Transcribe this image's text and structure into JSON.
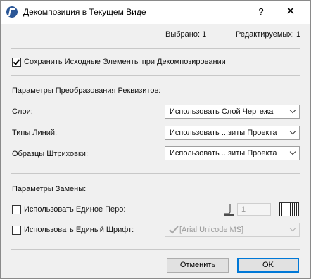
{
  "window": {
    "title": "Декомпозиция в Текущем Виде",
    "help": "?",
    "close": "✕"
  },
  "status": {
    "selected": "Выбрано: 1",
    "editable": "Редактируемых: 1"
  },
  "keep_original": {
    "label": "Сохранить Исходные Элементы при Декомпозировании",
    "checked": true
  },
  "attributes": {
    "heading": "Параметры Преобразования Реквизитов:",
    "layers": {
      "label": "Слои:",
      "value": "Использовать Слой Чертежа"
    },
    "line_types": {
      "label": "Типы Линий:",
      "value": "Использовать ...зиты Проекта"
    },
    "hatches": {
      "label": "Образцы Штриховки:",
      "value": "Использовать ...зиты Проекта"
    }
  },
  "overrides": {
    "heading": "Параметры Замены:",
    "single_pen": {
      "label": "Использовать Единое Перо:",
      "checked": false,
      "pen_number": "1"
    },
    "single_font": {
      "label": "Использовать Единый Шрифт:",
      "checked": false,
      "font_value": "[Arial Unicode MS]"
    }
  },
  "buttons": {
    "cancel": "Отменить",
    "ok": "OK"
  }
}
